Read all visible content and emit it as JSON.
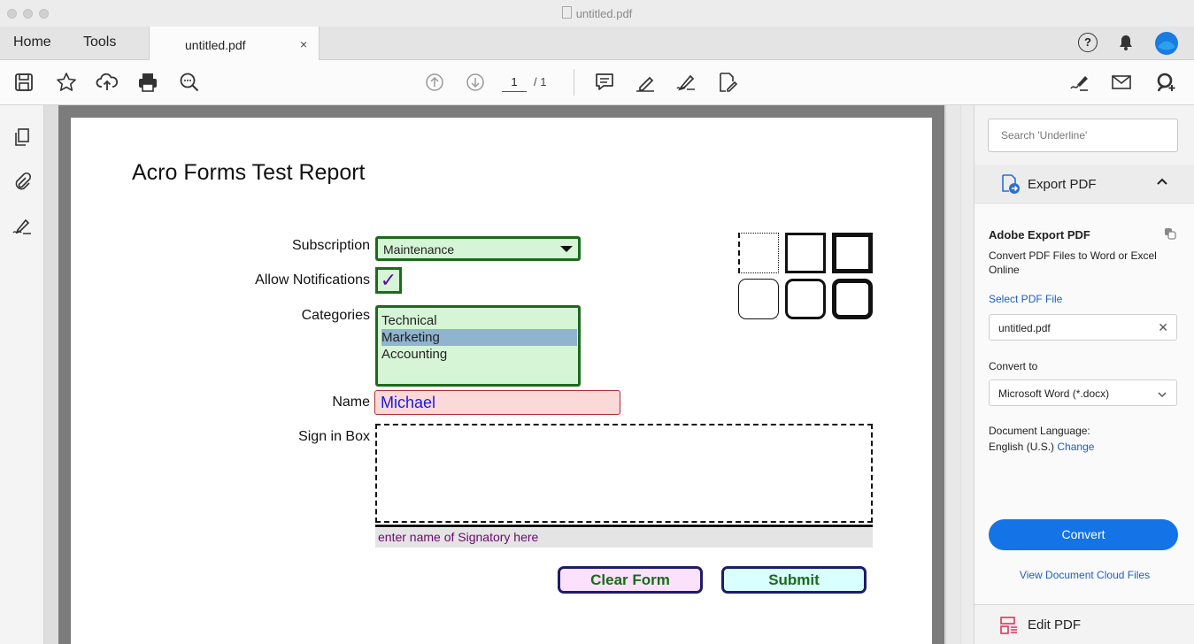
{
  "window": {
    "title": "untitled.pdf"
  },
  "tabs": {
    "home": "Home",
    "tools": "Tools",
    "document": "untitled.pdf",
    "close": "×"
  },
  "toolbar": {
    "page_current": "1",
    "page_total": "/ 1"
  },
  "document": {
    "title": "Acro Forms Test Report",
    "subscription": {
      "label": "Subscription",
      "value": "Maintenance"
    },
    "notifications": {
      "label": "Allow Notifications",
      "check": "✓"
    },
    "categories": {
      "label": "Categories",
      "options": [
        "Technical",
        "Marketing",
        "Accounting"
      ],
      "selected": "Marketing"
    },
    "name": {
      "label": "Name",
      "value": "Michael"
    },
    "sign": {
      "label": "Sign in Box",
      "hint": "enter name of Signatory here"
    },
    "buttons": {
      "clear": "Clear Form",
      "submit": "Submit"
    }
  },
  "right_panel": {
    "search_placeholder": "Search 'Underline'",
    "export_title": "Export PDF",
    "export_chevron": "^",
    "adobe_export_title": "Adobe Export PDF",
    "description": "Convert PDF Files to Word or Excel Online",
    "select_file_link": "Select PDF File",
    "file_name": "untitled.pdf",
    "file_clear": "✕",
    "convert_to_label": "Convert to",
    "convert_to_value": "Microsoft Word (*.docx)",
    "doc_language_label": "Document Language:",
    "doc_language_value": "English (U.S.)",
    "change_link": "Change",
    "convert_button": "Convert",
    "view_cloud_link": "View Document Cloud Files",
    "edit_pdf": "Edit PDF"
  },
  "colors": {
    "accent": "#1473e6",
    "form_green": "#1b6b1b",
    "form_field_bg": "#d6f5d6",
    "name_field_bg": "#fcd9d9"
  }
}
